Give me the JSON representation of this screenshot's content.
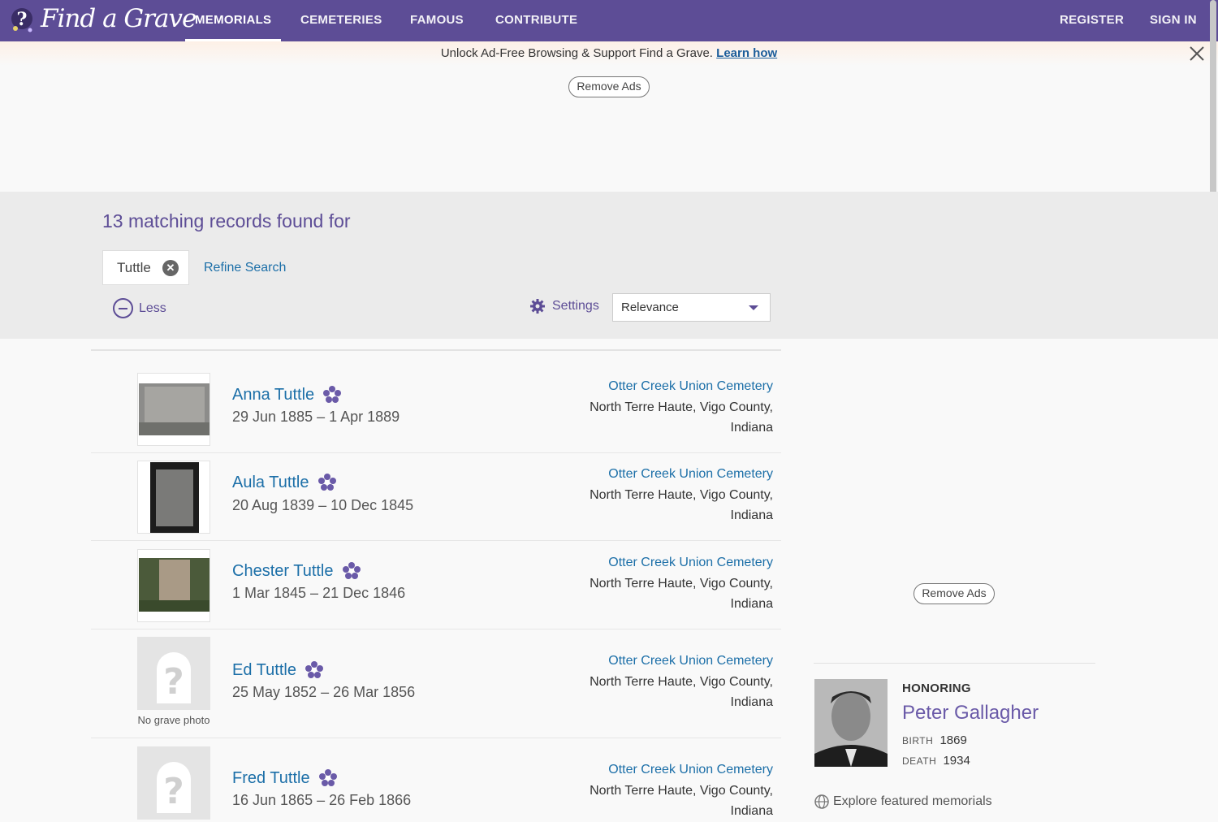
{
  "nav": {
    "logo_text": "Find a Grave",
    "items": [
      "MEMORIALS",
      "CEMETERIES",
      "FAMOUS",
      "CONTRIBUTE"
    ],
    "register": "REGISTER",
    "sign_in": "SIGN IN"
  },
  "banner": {
    "text": "Unlock Ad-Free Browsing & Support Find a Grave.",
    "link": "Learn how"
  },
  "remove_ads": "Remove Ads",
  "search": {
    "results_title": "13 matching records found for",
    "chip": "Tuttle",
    "refine": "Refine Search",
    "less": "Less",
    "settings": "Settings",
    "sort_value": "Relevance"
  },
  "results": [
    {
      "name": "Anna Tuttle",
      "dates": "29 Jun 1885 – 1 Apr 1889",
      "cemetery": "Otter Creek Union Cemetery",
      "location1": "North Terre Haute, Vigo County,",
      "location2": "Indiana",
      "photo": true
    },
    {
      "name": "Aula Tuttle",
      "dates": "20 Aug 1839 – 10 Dec 1845",
      "cemetery": "Otter Creek Union Cemetery",
      "location1": "North Terre Haute, Vigo County,",
      "location2": "Indiana",
      "photo": true
    },
    {
      "name": "Chester Tuttle",
      "dates": "1 Mar 1845 – 21 Dec 1846",
      "cemetery": "Otter Creek Union Cemetery",
      "location1": "North Terre Haute, Vigo County,",
      "location2": "Indiana",
      "photo": true
    },
    {
      "name": "Ed Tuttle",
      "dates": "25 May 1852 – 26 Mar 1856",
      "cemetery": "Otter Creek Union Cemetery",
      "location1": "North Terre Haute, Vigo County,",
      "location2": "Indiana",
      "photo": false,
      "no_photo_label": "No grave photo"
    },
    {
      "name": "Fred Tuttle",
      "dates": "16 Jun 1865 – 26 Feb 1866",
      "cemetery": "Otter Creek Union Cemetery",
      "location1": "North Terre Haute, Vigo County,",
      "location2": "Indiana",
      "photo": false
    }
  ],
  "sidebar": {
    "remove_ads": "Remove Ads",
    "honoring_label": "HONORING",
    "honoring_name": "Peter Gallagher",
    "birth_label": "BIRTH",
    "birth_year": "1869",
    "death_label": "DEATH",
    "death_year": "1934",
    "explore": "Explore featured memorials"
  },
  "colors": {
    "brand_purple": "#5d4d96",
    "link_blue": "#1c6fa8"
  }
}
